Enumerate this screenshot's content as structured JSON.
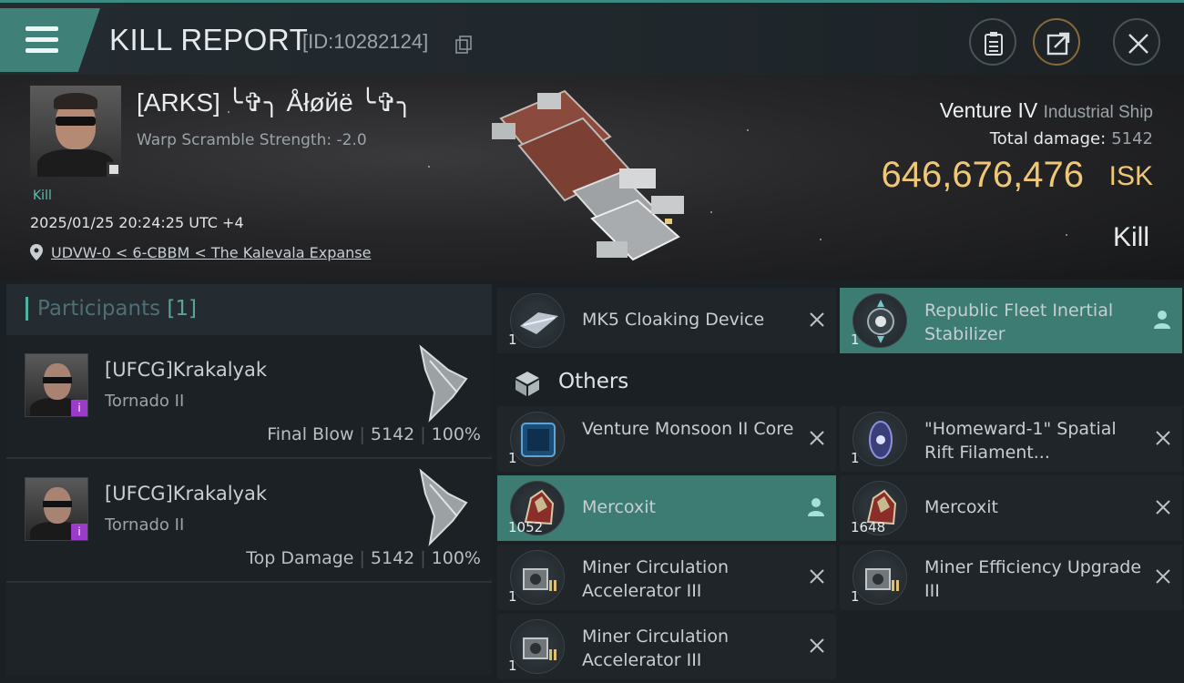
{
  "header": {
    "title": "KILL REPORT",
    "report_id": "[ID:10282124]"
  },
  "victim": {
    "name": "[ARKS] ╰✞╮ Åłøйë ╰✞╮",
    "warp_scramble": "Warp Scramble Strength: -2.0",
    "tag": "Kill",
    "datetime": "2025/01/25 20:24:25 UTC +4",
    "location": "UDVW-0 < 6-CBBM < The Kalevala Expanse"
  },
  "ship": {
    "name": "Venture IV",
    "class": "Industrial Ship",
    "total_damage_label": "Total damage:",
    "total_damage": "5142",
    "isk_value": "646,676,476",
    "isk_unit": "ISK",
    "result": "Kill"
  },
  "participants": {
    "label": "Participants",
    "count": "[1]",
    "rows": [
      {
        "name": "[UFCG]Krakalyak",
        "ship": "Tornado II",
        "role": "Final Blow",
        "damage": "5142",
        "percent": "100%"
      },
      {
        "name": "[UFCG]Krakalyak",
        "ship": "Tornado II",
        "role": "Top Damage",
        "damage": "5142",
        "percent": "100%"
      }
    ]
  },
  "items": {
    "top": [
      {
        "name": "MK5 Cloaking Device",
        "qty": "1",
        "status": "destroyed"
      },
      {
        "name": "Republic Fleet Inertial Stabilizer",
        "qty": "1",
        "status": "dropped"
      }
    ],
    "others_label": "Others",
    "others": [
      {
        "name": "Venture Monsoon II Core",
        "qty": "1",
        "status": "destroyed"
      },
      {
        "name": "\"Homeward-1\" Spatial Rift Filament...",
        "qty": "1",
        "status": "destroyed"
      },
      {
        "name": "Mercoxit",
        "qty": "1052",
        "status": "dropped"
      },
      {
        "name": "Mercoxit",
        "qty": "1648",
        "status": "destroyed"
      },
      {
        "name": "Miner Circulation Accelerator III",
        "qty": "1",
        "status": "destroyed"
      },
      {
        "name": "Miner Efficiency Upgrade III",
        "qty": "1",
        "status": "destroyed"
      },
      {
        "name": "Miner Circulation Accelerator III",
        "qty": "1",
        "status": "destroyed"
      }
    ]
  },
  "colors": {
    "accent_teal": "#3d7c73",
    "isk_gold": "#f0c777",
    "badge_purple": "#9a3cc9"
  }
}
